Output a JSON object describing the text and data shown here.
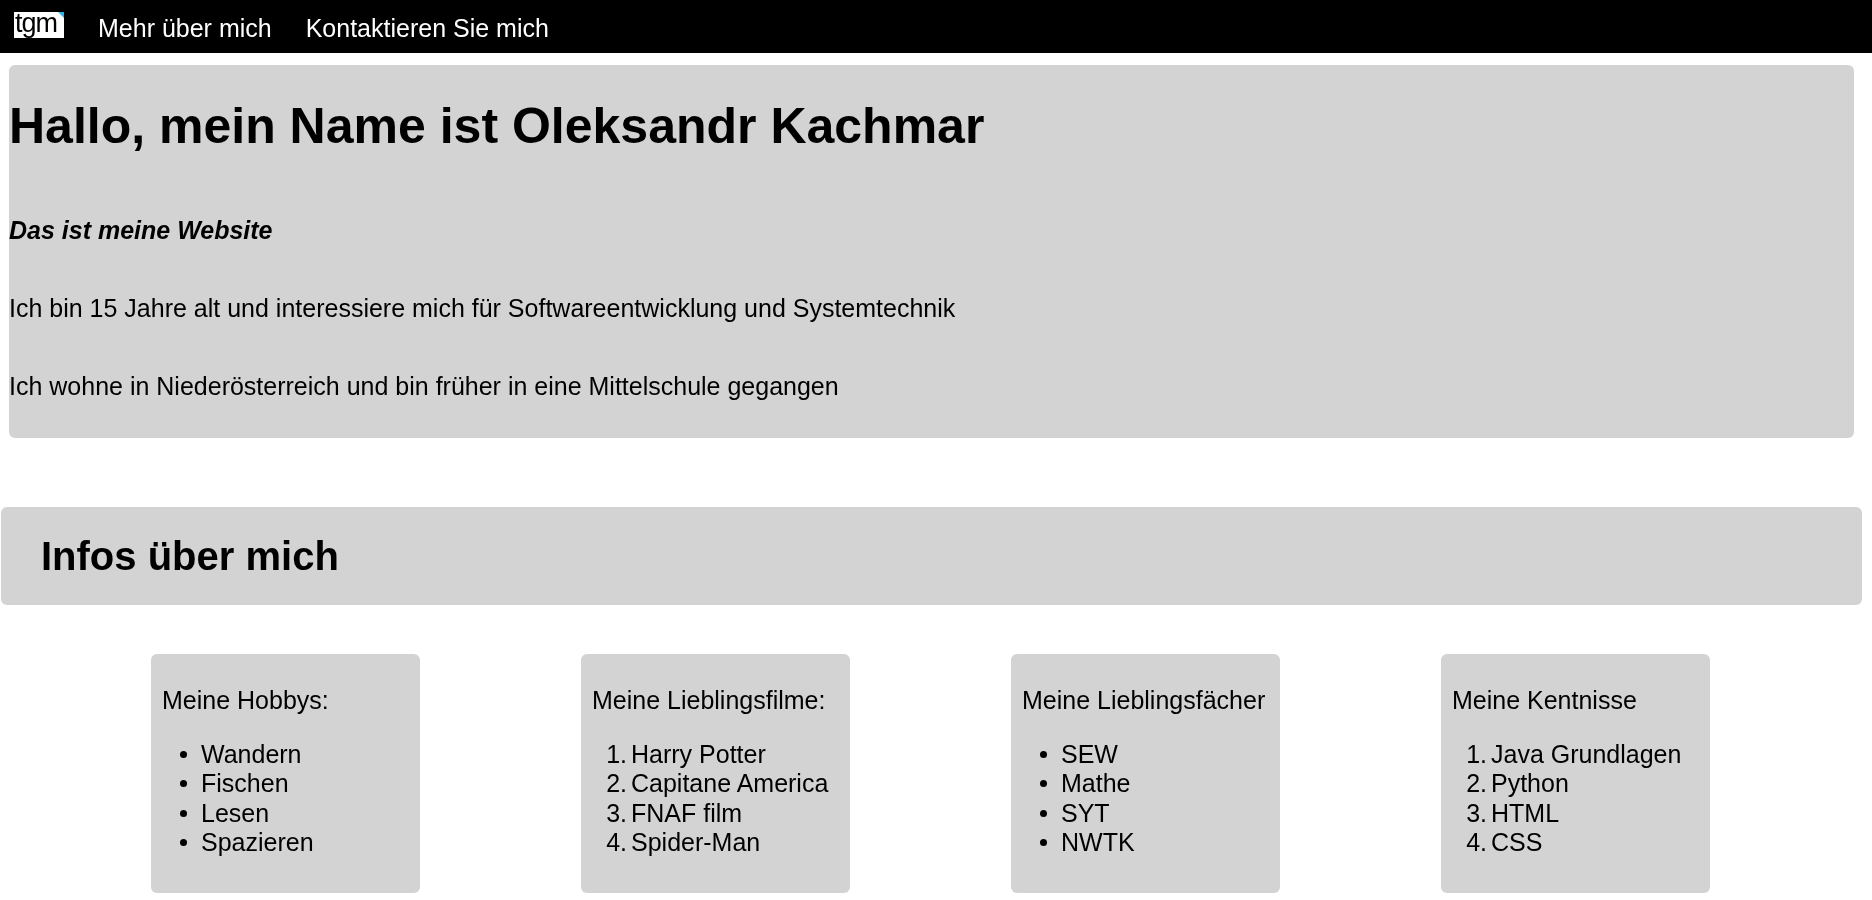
{
  "nav": {
    "logo": "tgm",
    "links": [
      "Mehr über mich",
      "Kontaktieren Sie mich"
    ]
  },
  "hero": {
    "title": "Hallo, mein Name ist Oleksandr Kachmar",
    "subtitle": "Das ist meine Website",
    "paragraphs": [
      "Ich bin 15 Jahre alt und interessiere mich für Softwareentwicklung und Systemtechnik",
      "Ich wohne in Niederösterreich und bin früher in eine Mittelschule gegangen"
    ]
  },
  "section": {
    "heading": "Infos über mich"
  },
  "cards": [
    {
      "title": "Meine Hobbys:",
      "kind": "bullet",
      "items": [
        {
          "text": "Wandern"
        },
        {
          "text": "Fischen"
        },
        {
          "text": "Lesen"
        },
        {
          "text": "Spazieren"
        }
      ]
    },
    {
      "title": "Meine Lieblingsfilme:",
      "kind": "numbered",
      "items": [
        {
          "number": "1.",
          "text": "Harry Potter"
        },
        {
          "number": "2.",
          "text": "Capitane America"
        },
        {
          "number": "3.",
          "text": "FNAF film"
        },
        {
          "number": "4.",
          "text": "Spider-Man"
        }
      ]
    },
    {
      "title": "Meine Lieblingsfächer",
      "kind": "bullet",
      "items": [
        {
          "text": "SEW"
        },
        {
          "text": "Mathe"
        },
        {
          "text": "SYT"
        },
        {
          "text": "NWTK"
        }
      ]
    },
    {
      "title": "Meine Kentnisse",
      "kind": "numbered",
      "items": [
        {
          "number": "1.",
          "text": "Java Grundlagen"
        },
        {
          "number": "2.",
          "text": "Python"
        },
        {
          "number": "3.",
          "text": "HTML"
        },
        {
          "number": "4.",
          "text": "CSS"
        }
      ]
    }
  ]
}
